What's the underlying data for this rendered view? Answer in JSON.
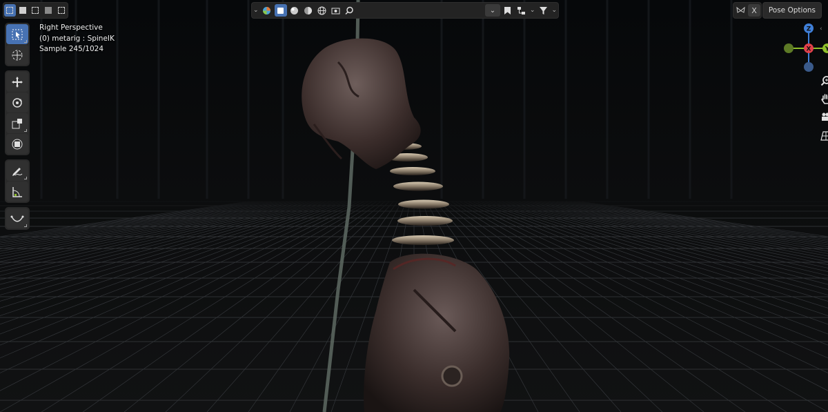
{
  "viewport": {
    "view_name": "Right Perspective",
    "active_object": "(0) metarig : SpineIK",
    "render_sample": "Sample 245/1024"
  },
  "header": {
    "pose_options_label": "Pose Options",
    "x_toggle_label": "X"
  },
  "gizmo": {
    "z_label": "Z",
    "y_label": "Y",
    "x_label": "X"
  },
  "colors": {
    "accent": "#4772b3",
    "axis_x": "#e0404a",
    "axis_y": "#8fbf2a",
    "axis_z": "#3f7fd8"
  }
}
